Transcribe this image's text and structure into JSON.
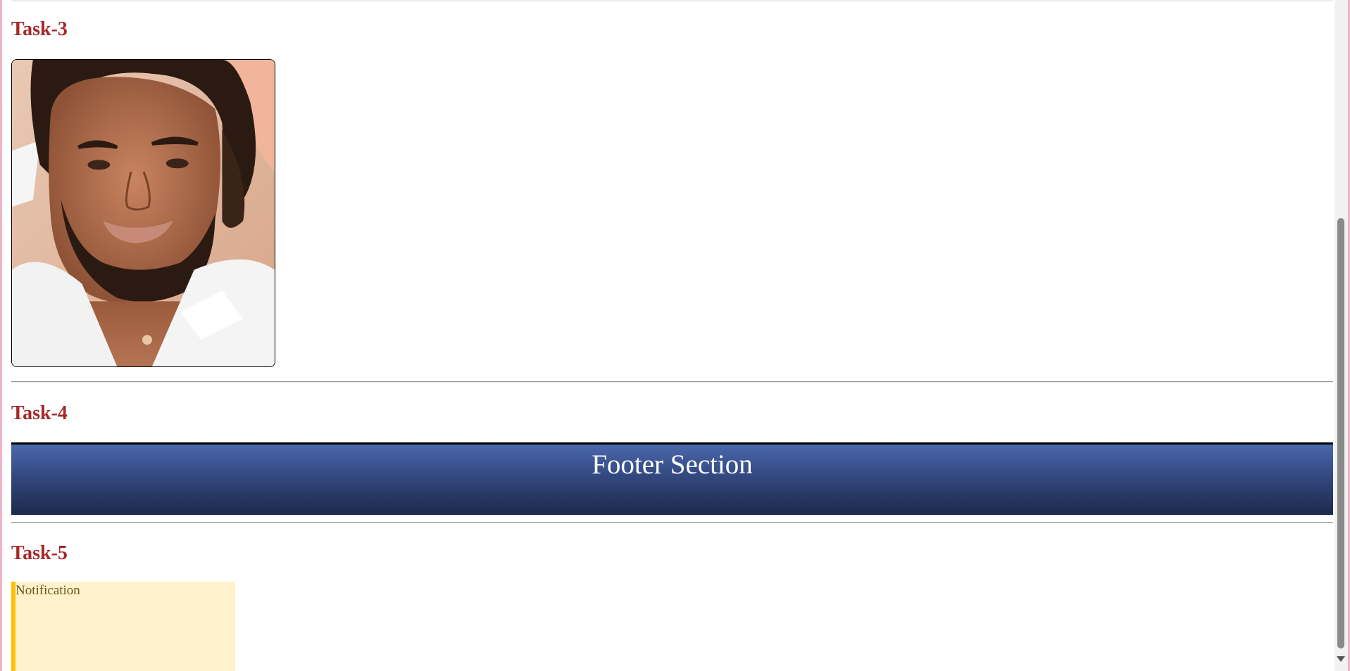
{
  "tasks": {
    "task3_title": "Task-3",
    "task4_title": "Task-4",
    "task5_title": "Task-5"
  },
  "footer": {
    "title": "Footer Section"
  },
  "notification": {
    "text": "Notification"
  },
  "colors": {
    "task_title": "#a52a2a",
    "footer_gradient_top": "#4a68ad",
    "footer_gradient_bottom": "#1d2a4c",
    "notification_bg": "#fff2cc",
    "notification_border": "#ffc107",
    "page_edge": "#f2b3c9"
  },
  "image": {
    "subject": "portrait-photo"
  }
}
